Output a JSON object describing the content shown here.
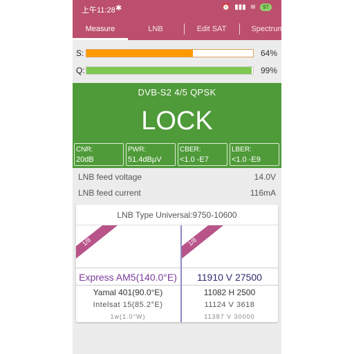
{
  "status_bar": {
    "time": "上午11:28",
    "bluetooth_icon": "bluetooth-icon",
    "icons_text": "⏰ 📶 ≋",
    "battery": "97"
  },
  "tabs": [
    {
      "label": "Measure",
      "active": true
    },
    {
      "label": "LNB",
      "active": false
    },
    {
      "label": "Edit SAT",
      "active": false
    },
    {
      "label": "Spectrum",
      "active": false
    }
  ],
  "meters": {
    "s": {
      "label": "S:",
      "value": "64%",
      "fraction": 0.64,
      "color": "#ff9a00"
    },
    "q": {
      "label": "Q:",
      "value": "99%",
      "fraction": 0.99,
      "color": "#7ec850"
    }
  },
  "signal": {
    "mode": "DVB-S2  4/5  QPSK",
    "state": "LOCK",
    "stats": [
      {
        "key": "CNR:",
        "value": "20dB"
      },
      {
        "key": "PWR:",
        "value": "51.4dBμV"
      },
      {
        "key": "CBER:",
        "value": "<1.0 -E7"
      },
      {
        "key": "LBER:",
        "value": "<1.0 -E9"
      }
    ]
  },
  "lnb": {
    "voltage_label": "LNB feed voltage",
    "voltage_value": "14.0V",
    "current_label": "LNB feed current",
    "current_value": "116mA"
  },
  "sat_card": {
    "lnb_type": "LNB Type   Universal:9750-10600",
    "left_badge": "1/8",
    "right_badge": "1/8",
    "satellites": [
      "Express AM5(140.0°E)",
      "Yamal 401(90.0°E)",
      "Intelsat 15(85.2°E)",
      "1w(1.0°W)"
    ],
    "transponders": [
      "11910 V 27500",
      "11082 H 2500",
      "11124 V 3618",
      "11387 V 30000"
    ],
    "accent": "#7a3a9a"
  }
}
